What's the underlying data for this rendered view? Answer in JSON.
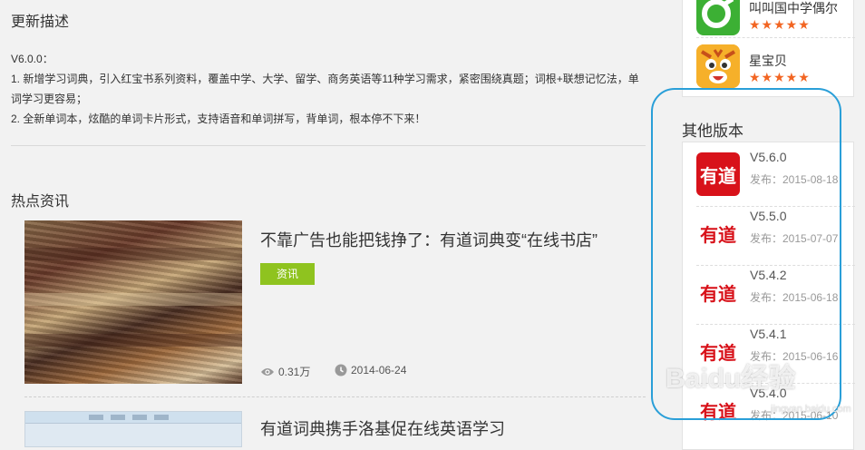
{
  "description": {
    "title": "更新描述",
    "version_line": "V6.0.0：",
    "items": [
      "1. 新增学习词典，引入红宝书系列资料，覆盖中学、大学、留学、商务英语等11种学习需求，紧密围绕真题；词根+联想记忆法，单词学习更容易；",
      "2. 全新单词本，炫酷的单词卡片形式，支持语音和单词拼写，背单词，根本停不下来！"
    ]
  },
  "news": {
    "title": "热点资讯",
    "items": [
      {
        "title": "不靠广告也能把钱挣了：有道词典变“在线书店”",
        "tag": "资讯",
        "views": "0.31万",
        "date": "2014-06-24"
      },
      {
        "title": "有道词典携手洛基促在线英语学习"
      }
    ]
  },
  "sidebar": {
    "apps": [
      {
        "name": "叫叫国中学偶尔",
        "stars": "★★★★★",
        "icon": "green-app-icon",
        "color": "#3cb034"
      },
      {
        "name": "星宝贝",
        "stars": "★★★★★",
        "icon": "tiger-cub-icon",
        "color": "#f5a623"
      }
    ],
    "other_versions_title": "其他版本",
    "versions": [
      {
        "logo": "有道",
        "version": "V5.6.0",
        "date": "发布：2015-08-18"
      },
      {
        "logo": "有道",
        "version": "V5.5.0",
        "date": "发布：2015-07-07"
      },
      {
        "logo": "有道",
        "version": "V5.4.2",
        "date": "发布：2015-06-18"
      },
      {
        "logo": "有道",
        "version": "V5.4.1",
        "date": "发布：2015-06-16"
      },
      {
        "logo": "有道",
        "version": "V5.4.0",
        "date": "发布：2015-06-10"
      }
    ]
  },
  "watermark": {
    "text": "Baidu经验",
    "sub": "jingyan.baidu.com"
  },
  "colors": {
    "tag_green": "#8fc31f",
    "star_orange": "#f26522",
    "youdao_red": "#d8121a",
    "highlight_blue": "#2a9fd8"
  }
}
